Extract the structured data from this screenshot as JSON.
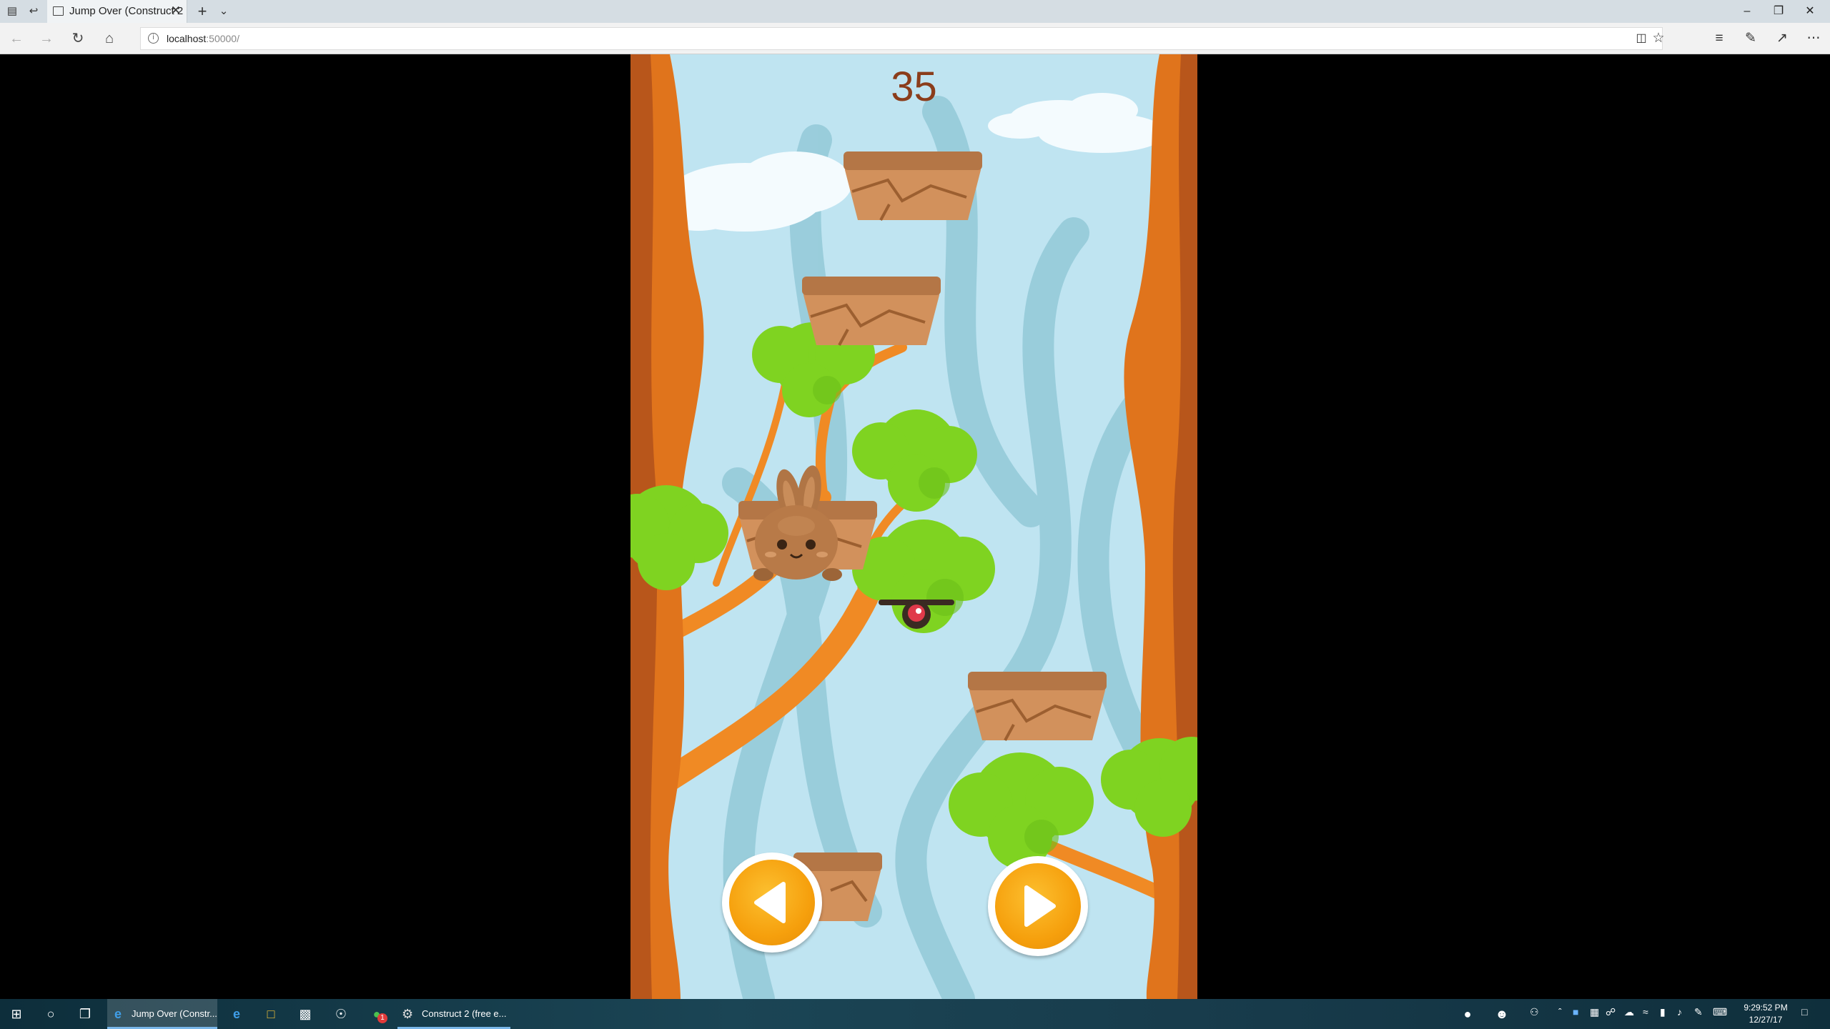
{
  "browser": {
    "tab_title": "Jump Over (Construct 2",
    "url_host": "localhost",
    "url_port": ":50000/"
  },
  "game": {
    "score": "35",
    "colors": {
      "sky": "#bfe4f1",
      "trunk": "#e0741c",
      "leaf": "#7fd321",
      "button": "#f6a00d",
      "score": "#8b3d1b"
    }
  },
  "taskbar": {
    "apps": [
      {
        "label": "Jump Over (Constr...",
        "icon": "edge-icon"
      },
      {
        "label": "Construct 2  (free e...",
        "icon": "construct-gear-icon"
      }
    ],
    "clock_time": "9:29:52 PM",
    "clock_date": "12/27/17",
    "notification_badge": "1"
  }
}
